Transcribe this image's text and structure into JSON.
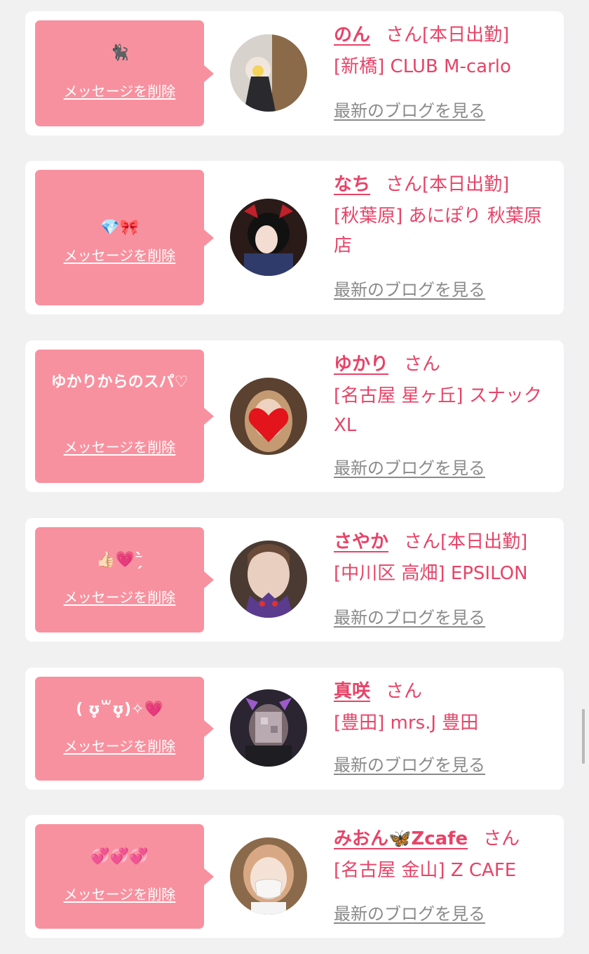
{
  "cards": [
    {
      "message": "🐈‍⬛",
      "delete_label": "メッセージを削除",
      "name": "のん",
      "honorific": "さん",
      "tag": "[本日出勤]",
      "shop": "[新橋] CLUB M-carlo",
      "blog_label": "最新のブログを見る"
    },
    {
      "message": "💎🎀",
      "delete_label": "メッセージを削除",
      "name": "なち",
      "honorific": "さん",
      "tag": "[本日出勤]",
      "shop": "[秋葉原] あにぽり 秋葉原店",
      "blog_label": "最新のブログを見る"
    },
    {
      "message": "ゆかりからのスパ♡",
      "delete_label": "メッセージを削除",
      "name": "ゆかり",
      "honorific": "さん",
      "tag": "",
      "shop": "[名古屋 星ヶ丘] スナック XL",
      "blog_label": "最新のブログを見る"
    },
    {
      "message": "👍🏻💗⁻̗̀",
      "delete_label": "メッセージを削除",
      "name": "さやか",
      "honorific": "さん",
      "tag": "[本日出勤]",
      "shop": "[中川区 高畑] EPSILON",
      "blog_label": "最新のブログを見る"
    },
    {
      "message": "( ʊ̥̥̥꒳ʊ̥̥̥)✧💗",
      "delete_label": "メッセージを削除",
      "name": "真咲",
      "honorific": "さん",
      "tag": "",
      "shop": "[豊田] mrs.J 豊田",
      "blog_label": "最新のブログを見る"
    },
    {
      "message": "💞💞💞",
      "delete_label": "メッセージを削除",
      "name": "みおん🦋Zcafe",
      "honorific": "さん",
      "tag": "",
      "shop": "[名古屋 金山] Z CAFE",
      "blog_label": "最新のブログを見る"
    }
  ],
  "colors": {
    "page_background": "#f1f1f2",
    "card_background": "#ffffff",
    "bubble": "#f8919f",
    "accent": "#e84367",
    "link_gray": "#8a8a8a"
  },
  "icons": [
    "avatar-photo",
    "speech-bubble-pointer"
  ]
}
